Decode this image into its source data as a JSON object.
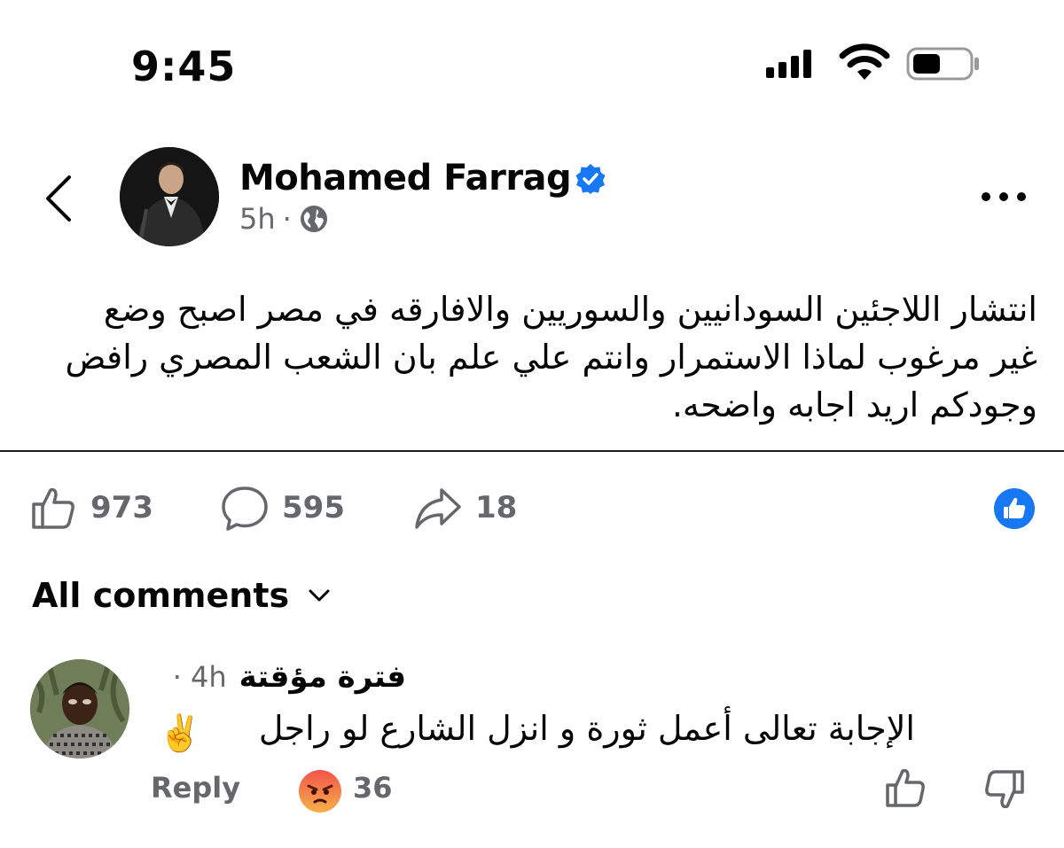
{
  "status_bar": {
    "time": "9:45"
  },
  "post": {
    "author": "Mohamed Farrag",
    "time": "5h",
    "separator": "·",
    "text": "انتشار اللاجئين السودانيين والسوريين والافارقه في مصر اصبح وضع غير مرغوب لماذا الاستمرار وانتم علي علم بان الشعب المصري رافض وجودكم اريد اجابه واضحه.",
    "reactions": {
      "likes": "973",
      "comments": "595",
      "shares": "18"
    }
  },
  "comments_section": {
    "sort_label": "All comments",
    "comments": [
      {
        "author": "فترة مؤقتة",
        "time": "4h",
        "separator": "·",
        "text": "الإجابة تعالى أعمل ثورة و انزل الشارع لو راجل",
        "emoji": "✌️",
        "reply_label": "Reply",
        "reaction_count": "36"
      }
    ]
  },
  "colors": {
    "accent": "#1877f2",
    "secondary_text": "#65676b",
    "angry": "#f07a3c"
  },
  "icons": [
    "back-chevron-icon",
    "verified-badge-icon",
    "globe-icon",
    "more-icon",
    "like-icon",
    "comment-icon",
    "share-icon",
    "like-reaction-icon",
    "chevron-down-icon",
    "angry-reaction-icon",
    "thumb-up-icon",
    "thumb-down-icon"
  ]
}
